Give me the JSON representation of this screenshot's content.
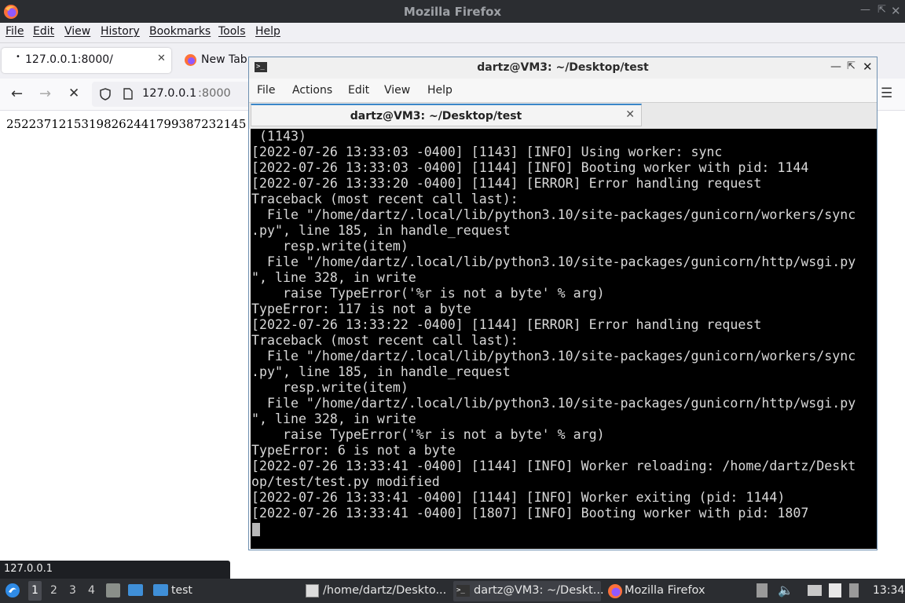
{
  "firefox": {
    "window_title": "Mozilla Firefox",
    "menu": [
      "File",
      "Edit",
      "View",
      "History",
      "Bookmarks",
      "Tools",
      "Help"
    ],
    "tabs": [
      {
        "label": "127.0.0.1:8000/",
        "active": true
      },
      {
        "label": "New Tab",
        "active": false
      }
    ],
    "url_host": "127.0.0.1",
    "url_port": ":8000",
    "page_text": "25223712153198262441799387232145",
    "status_url": "127.0.0.1"
  },
  "terminal": {
    "window_title": "dartz@VM3: ~/Desktop/test",
    "menu": [
      "File",
      "Actions",
      "Edit",
      "View",
      "Help"
    ],
    "tab_label": "dartz@VM3: ~/Desktop/test",
    "lines": [
      " (1143)",
      "[2022-07-26 13:33:03 -0400] [1143] [INFO] Using worker: sync",
      "[2022-07-26 13:33:03 -0400] [1144] [INFO] Booting worker with pid: 1144",
      "[2022-07-26 13:33:20 -0400] [1144] [ERROR] Error handling request",
      "Traceback (most recent call last):",
      "  File \"/home/dartz/.local/lib/python3.10/site-packages/gunicorn/workers/sync",
      ".py\", line 185, in handle_request",
      "    resp.write(item)",
      "  File \"/home/dartz/.local/lib/python3.10/site-packages/gunicorn/http/wsgi.py",
      "\", line 328, in write",
      "    raise TypeError('%r is not a byte' % arg)",
      "TypeError: 117 is not a byte",
      "[2022-07-26 13:33:22 -0400] [1144] [ERROR] Error handling request",
      "Traceback (most recent call last):",
      "  File \"/home/dartz/.local/lib/python3.10/site-packages/gunicorn/workers/sync",
      ".py\", line 185, in handle_request",
      "    resp.write(item)",
      "  File \"/home/dartz/.local/lib/python3.10/site-packages/gunicorn/http/wsgi.py",
      "\", line 328, in write",
      "    raise TypeError('%r is not a byte' % arg)",
      "TypeError: 6 is not a byte",
      "[2022-07-26 13:33:41 -0400] [1144] [INFO] Worker reloading: /home/dartz/Deskt",
      "op/test/test.py modified",
      "[2022-07-26 13:33:41 -0400] [1144] [INFO] Worker exiting (pid: 1144)",
      "[2022-07-26 13:33:41 -0400] [1807] [INFO] Booting worker with pid: 1807"
    ]
  },
  "taskbar": {
    "workspaces": [
      "1",
      "2",
      "3",
      "4"
    ],
    "folder_label": "test",
    "tasks": [
      {
        "label": "/home/dartz/Deskto...",
        "icon": "text-editor-icon"
      },
      {
        "label": "dartz@VM3: ~/Deskt...",
        "icon": "terminal-icon"
      },
      {
        "label": "Mozilla Firefox",
        "icon": "firefox-icon"
      }
    ],
    "clock": "13:34"
  },
  "colors": {
    "terminal_bg": "#000000",
    "terminal_fg": "#d8d8d8",
    "panel_bg": "#2b2d31",
    "accent": "#3a86c8"
  }
}
